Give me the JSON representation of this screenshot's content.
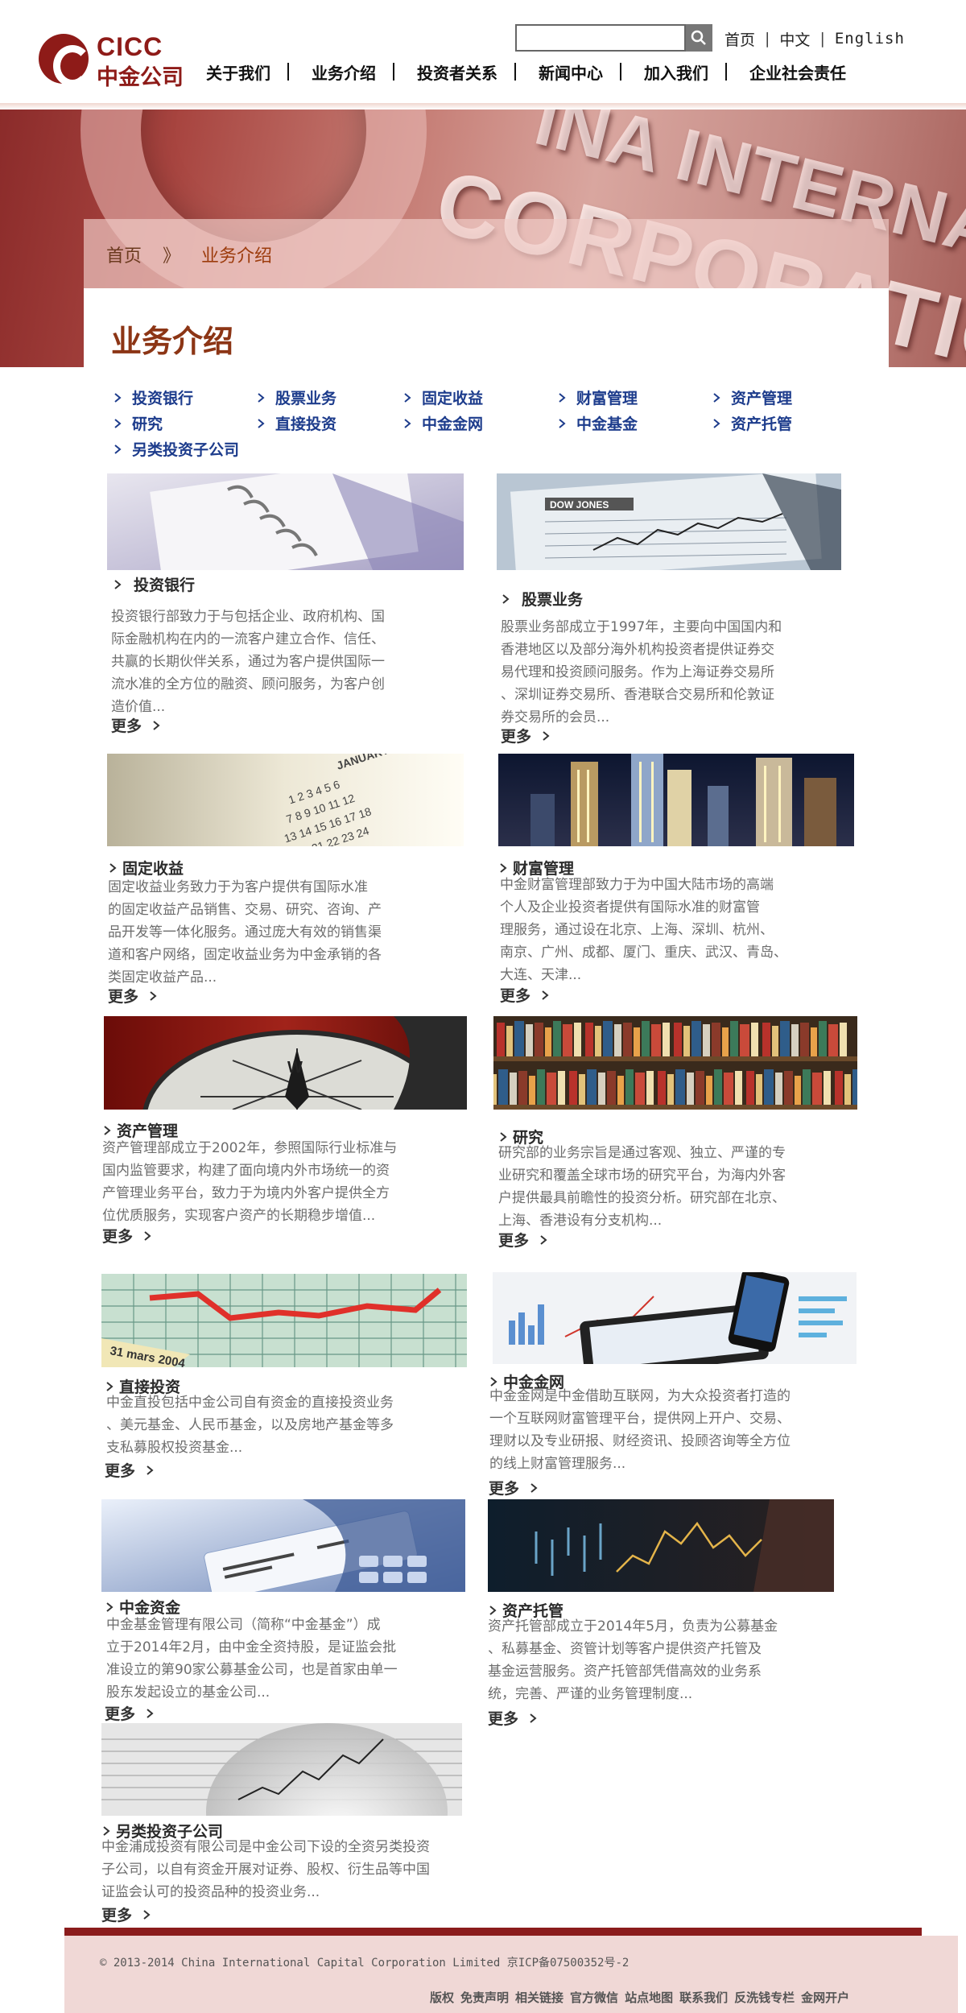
{
  "logo": {
    "en": "CICC",
    "cn": "中金公司"
  },
  "search": {
    "placeholder": "",
    "value": ""
  },
  "lang": {
    "home": "首页",
    "chinese": "中文",
    "english": "English"
  },
  "nav": [
    "关于我们",
    "业务介绍",
    "投资者关系",
    "新闻中心",
    "加入我们",
    "企业社会责任"
  ],
  "banner": {
    "text_line1": "CORPORATIO",
    "text_line2": "INA INTERNATIONAL"
  },
  "breadcrumb": {
    "home": "首页",
    "separator": "》",
    "current": "业务介绍"
  },
  "page": {
    "title": "业务介绍"
  },
  "subnav": [
    "投资银行",
    "股票业务",
    "固定收益",
    "财富管理",
    "资产管理",
    "研究",
    "直接投资",
    "中金金网",
    "中金基金",
    "资产托管",
    "另类投资子公司"
  ],
  "more_label": "更多",
  "cards": [
    {
      "title": "投资银行",
      "desc": [
        "投资银行部致力于与包括企业、政府机构、国",
        "际金融机构在内的一流客户建立合作、信任、",
        "共赢的长期伙伴关系，通过为客户提供国际一",
        "流水准的全方位的融资、顾问服务，为客户创",
        "造价值..."
      ]
    },
    {
      "title": "股票业务",
      "desc": [
        "股票业务部成立于1997年，主要向中国国内和",
        "香港地区以及部分海外机构投资者提供证券交",
        "易代理和投资顾问服务。作为上海证券交易所",
        "、深圳证券交易所、香港联合交易所和伦敦证",
        "券交易所的会员..."
      ]
    },
    {
      "title": "固定收益",
      "desc": [
        "固定收益业务致力于为客户提供有国际水准",
        "的固定收益产品销售、交易、研究、咨询、产",
        "品开发等一体化服务。通过庞大有效的销售渠",
        "道和客户网络，固定收益业务为中金承销的各",
        "类固定收益产品..."
      ]
    },
    {
      "title": "财富管理",
      "desc": [
        "中金财富管理部致力于为中国大陆市场的高端",
        "个人及企业投资者提供有国际水准的财富管",
        "理服务，通过设在北京、上海、深圳、杭州、",
        "南京、广州、成都、厦门、重庆、武汉、青岛、",
        "大连、天津..."
      ]
    },
    {
      "title": "资产管理",
      "desc": [
        "资产管理部成立于2002年，参照国际行业标准与",
        "国内监管要求，构建了面向境内外市场统一的资",
        "产管理业务平台，致力于为境内外客户提供全方",
        "位优质服务，实现客户资产的长期稳步增值..."
      ]
    },
    {
      "title": "研究",
      "desc": [
        "研究部的业务宗旨是通过客观、独立、严谨的专",
        "业研究和覆盖全球市场的研究平台，为海内外客",
        "户提供最具前瞻性的投资分析。研究部在北京、",
        "上海、香港设有分支机构..."
      ]
    },
    {
      "title": "直接投资",
      "desc": [
        "中金直投包括中金公司自有资金的直接投资业务",
        "、美元基金、人民币基金，以及房地产基金等多",
        "支私募股权投资基金..."
      ]
    },
    {
      "title": "中金金网",
      "desc": [
        "中金金网是中金借助互联网，为大众投资者打造的",
        "一个互联网财富管理平台，提供网上开户、交易、",
        "理财以及专业研报、财经资讯、投顾咨询等全方位",
        "的线上财富管理服务..."
      ]
    },
    {
      "title": "中金资金",
      "desc": [
        "中金基金管理有限公司（简称“中金基金”）成",
        "立于2014年2月，由中金全资持股，是证监会批",
        "准设立的第90家公募基金公司，也是首家由单一",
        "股东发起设立的基金公司..."
      ]
    },
    {
      "title": "资产托管",
      "desc": [
        "资产托管部成立于2014年5月，负责为公募基金",
        "、私募基金、资管计划等客户提供资产托管及",
        "基金运营服务。资产托管部凭借高效的业务系",
        "统，完善、严谨的业务管理制度..."
      ]
    },
    {
      "title": "另类投资子公司",
      "desc": [
        "中金浦成投资有限公司是中金公司下设的全资另类投资",
        "子公司，以自有资金开展对证券、股权、衍生品等中国",
        "证监会认可的投资品种的投资业务..."
      ]
    }
  ],
  "footer": {
    "copyright": "© 2013-2014 China International Capital Corporation Limited  京ICP备07500352号-2",
    "links": [
      "版权",
      "免责声明",
      "相关链接",
      "官方微信",
      "站点地图",
      "联系我们",
      "反洗钱专栏",
      "金网开户"
    ]
  }
}
